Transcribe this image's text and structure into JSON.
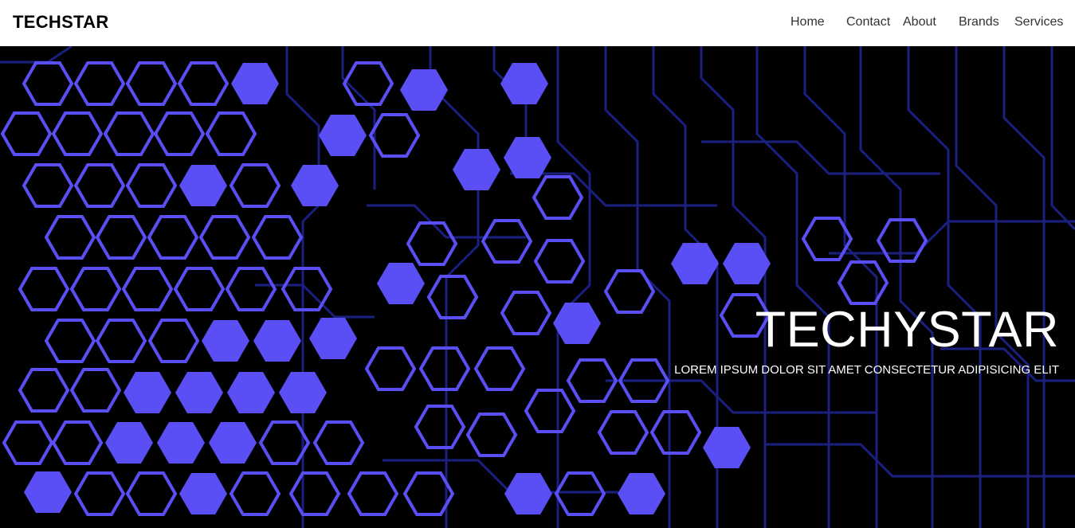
{
  "navbar": {
    "brand": "TECHSTAR",
    "links": [
      "Home",
      "Contact",
      "About",
      "Brands",
      "Services"
    ]
  },
  "hero": {
    "title": "TECHYSTAR",
    "subtitle": "LOREM IPSUM DOLOR SIT AMET CONSECTETUR ADIPISICING ELIT"
  },
  "colors": {
    "hex_accent": "#5a4ff5",
    "circuit_trace": "#1a2080",
    "navbar_bg": "#ffffff",
    "hero_bg": "#000000"
  }
}
